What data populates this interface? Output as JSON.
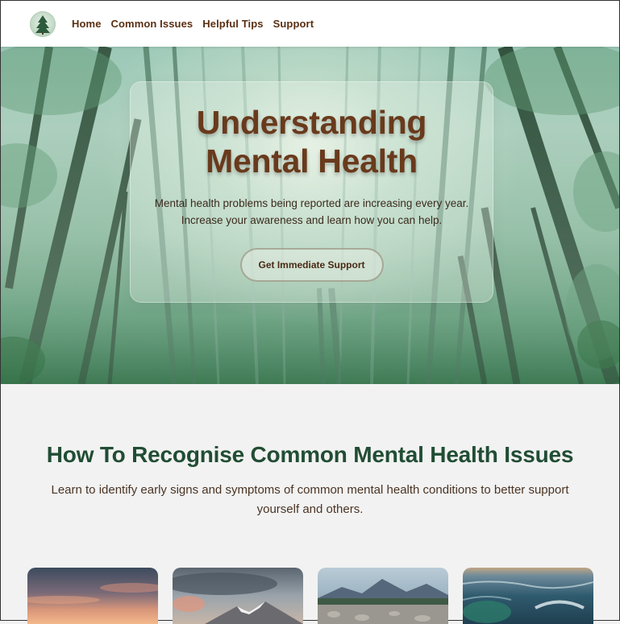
{
  "nav": {
    "logo_icon": "pine-tree-logo-icon",
    "links": [
      "Home",
      "Common Issues",
      "Helpful Tips",
      "Support"
    ]
  },
  "hero": {
    "title_line1": "Understanding",
    "title_line2": "Mental Health",
    "text_line1": "Mental health problems being reported are increasing every year.",
    "text_line2": "Increase your awareness and learn how you can help.",
    "button_label": "Get Immediate Support"
  },
  "section": {
    "title": "How To Recognise Common Mental Health Issues",
    "description": "Learn to identify early signs and symptoms of common mental health conditions to better support yourself and others."
  },
  "cards": [
    {
      "image": "sunset-sky-image"
    },
    {
      "image": "snowy-mountain-image"
    },
    {
      "image": "mountain-lake-pebbles-image"
    },
    {
      "image": "ocean-wave-image"
    }
  ],
  "colors": {
    "nav_text": "#5a2f12",
    "hero_title": "#6a3a1c",
    "section_title": "#214d34",
    "page_bg": "#f2f2f2"
  }
}
